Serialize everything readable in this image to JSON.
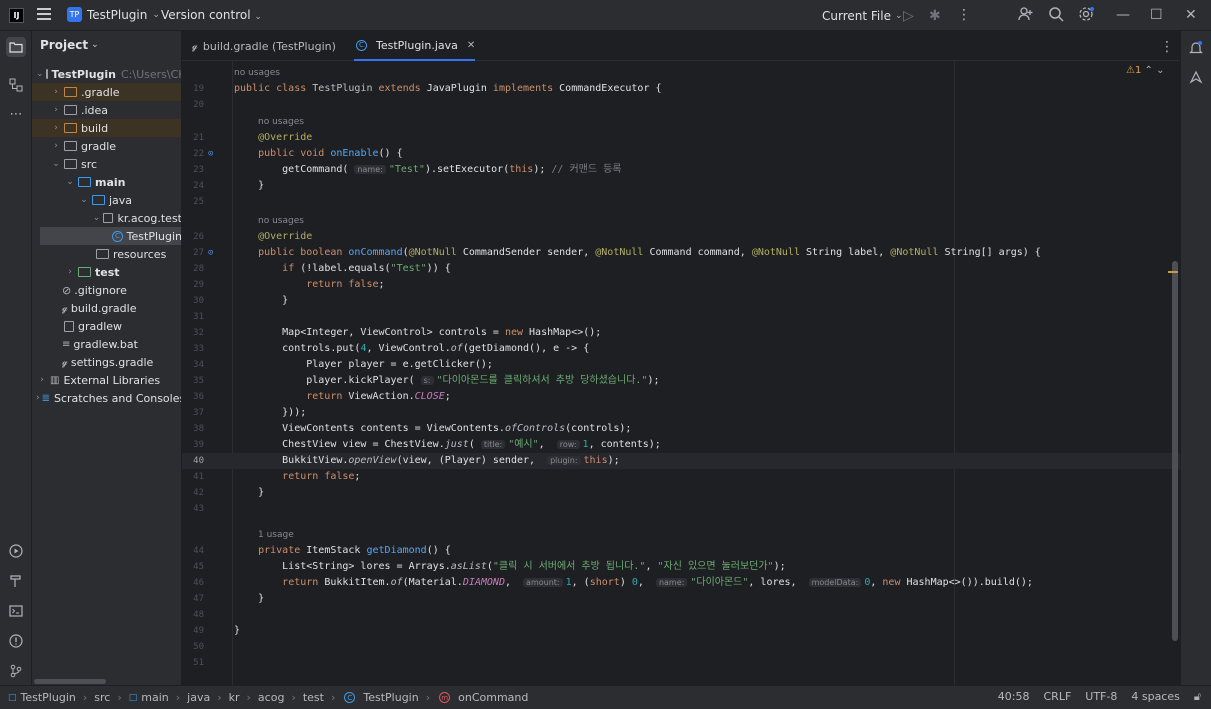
{
  "titlebar": {
    "logo": "IJ",
    "project_badge": "TP",
    "project_name": "TestPlugin",
    "vcs": "Version control",
    "run_config": "Current File"
  },
  "project_panel": {
    "title": "Project",
    "root": "TestPlugin",
    "root_path": "C:\\Users\\CKI",
    "items": [
      {
        "label": ".gradle"
      },
      {
        "label": ".idea"
      },
      {
        "label": "build"
      },
      {
        "label": "gradle"
      },
      {
        "label": "src"
      },
      {
        "label": "main"
      },
      {
        "label": "java"
      },
      {
        "label": "kr.acog.test"
      },
      {
        "label": "TestPlugin"
      },
      {
        "label": "resources"
      },
      {
        "label": "test"
      },
      {
        "label": ".gitignore"
      },
      {
        "label": "build.gradle"
      },
      {
        "label": "gradlew"
      },
      {
        "label": "gradlew.bat"
      },
      {
        "label": "settings.gradle"
      },
      {
        "label": "External Libraries"
      },
      {
        "label": "Scratches and Consoles"
      }
    ]
  },
  "tabs": [
    {
      "label": "build.gradle (TestPlugin)"
    },
    {
      "label": "TestPlugin.java"
    }
  ],
  "editor": {
    "warning_count": "1",
    "hints": {
      "no_usages": "no usages",
      "one_usage": "1 usage"
    },
    "line_numbers": [
      "19",
      "20",
      "21",
      "22",
      "23",
      "24",
      "25",
      "26",
      "27",
      "28",
      "29",
      "30",
      "31",
      "32",
      "33",
      "34",
      "35",
      "36",
      "37",
      "38",
      "39",
      "40",
      "41",
      "42",
      "43",
      "44",
      "45",
      "46",
      "47",
      "48",
      "49",
      "50",
      "51"
    ],
    "inlays": {
      "name": "name:",
      "s": "s:",
      "title": "title:",
      "row": "row:",
      "plugin": "plugin:",
      "amount": "amount:",
      "modelData": "modelData:"
    },
    "strings": {
      "test": "\"Test\"",
      "comment": "// 커맨드 등록",
      "kick": "\"다이아몬드를 클릭하셔서 추방 당하셨습니다.\"",
      "example": "\"예시\"",
      "lore1": "\"클릭 시 서버에서 추방 됩니다.\"",
      "lore2": "\"자신 있으면 눌러보던가\"",
      "diamond": "\"다이아몬드\""
    }
  },
  "statusbar": {
    "breadcrumb": [
      "TestPlugin",
      "src",
      "main",
      "java",
      "kr",
      "acog",
      "test",
      "TestPlugin",
      "onCommand"
    ],
    "position": "40:58",
    "line_sep": "CRLF",
    "encoding": "UTF-8",
    "indent": "4 spaces"
  }
}
